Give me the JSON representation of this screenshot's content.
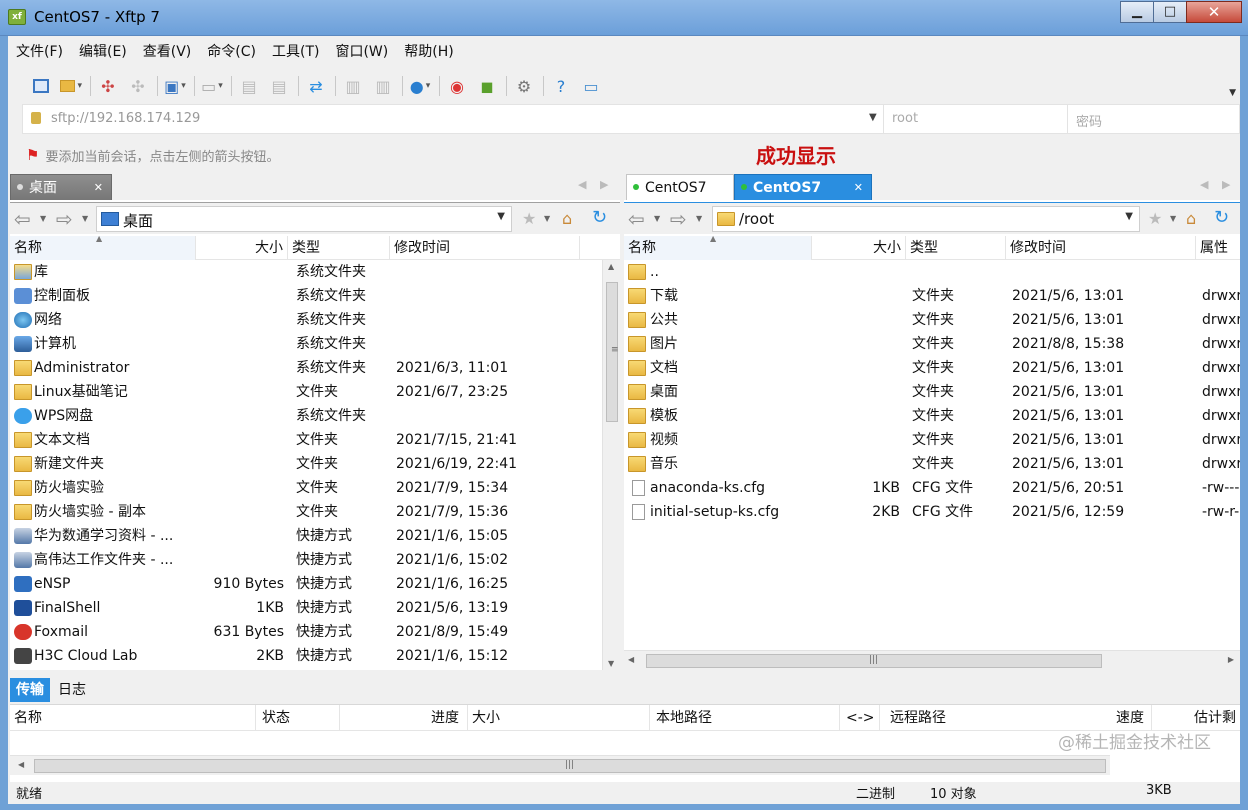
{
  "window": {
    "title": "CentOS7 - Xftp 7",
    "app_icon_text": "xf",
    "minimize": "▁",
    "maximize": "□",
    "close": "✕"
  },
  "menu": [
    "文件(F)",
    "编辑(E)",
    "查看(V)",
    "命令(C)",
    "工具(T)",
    "窗口(W)",
    "帮助(H)"
  ],
  "address": {
    "url": "sftp://192.168.174.129",
    "user_placeholder": "root",
    "password_placeholder": "密码"
  },
  "hint": "要添加当前会话，点击左侧的箭头按钮。",
  "annotation": "成功显示",
  "left_pane": {
    "tab_label": "桌面",
    "path": "桌面",
    "columns": [
      "名称",
      "大小",
      "类型",
      "修改时间"
    ],
    "rows": [
      {
        "name": "库",
        "size": "",
        "type": "系统文件夹",
        "modified": "",
        "icon": "library-icon"
      },
      {
        "name": "控制面板",
        "size": "",
        "type": "系统文件夹",
        "modified": "",
        "icon": "control-panel-icon"
      },
      {
        "name": "网络",
        "size": "",
        "type": "系统文件夹",
        "modified": "",
        "icon": "network-icon"
      },
      {
        "name": "计算机",
        "size": "",
        "type": "系统文件夹",
        "modified": "",
        "icon": "computer-icon"
      },
      {
        "name": "Administrator",
        "size": "",
        "type": "系统文件夹",
        "modified": "2021/6/3, 11:01",
        "icon": "folder-icon"
      },
      {
        "name": "Linux基础笔记",
        "size": "",
        "type": "文件夹",
        "modified": "2021/6/7, 23:25",
        "icon": "folder-icon"
      },
      {
        "name": "WPS网盘",
        "size": "",
        "type": "系统文件夹",
        "modified": "",
        "icon": "cloud-icon"
      },
      {
        "name": "文本文档",
        "size": "",
        "type": "文件夹",
        "modified": "2021/7/15, 21:41",
        "icon": "folder-icon"
      },
      {
        "name": "新建文件夹",
        "size": "",
        "type": "文件夹",
        "modified": "2021/6/19, 22:41",
        "icon": "folder-icon"
      },
      {
        "name": "防火墙实验",
        "size": "",
        "type": "文件夹",
        "modified": "2021/7/9, 15:34",
        "icon": "folder-icon"
      },
      {
        "name": "防火墙实验 - 副本",
        "size": "",
        "type": "文件夹",
        "modified": "2021/7/9, 15:36",
        "icon": "folder-icon"
      },
      {
        "name": "华为数通学习资料 - ...",
        "size": "",
        "type": "快捷方式",
        "modified": "2021/1/6, 15:05",
        "icon": "shortcut-icon"
      },
      {
        "name": "高伟达工作文件夹 - ...",
        "size": "",
        "type": "快捷方式",
        "modified": "2021/1/6, 15:02",
        "icon": "shortcut-icon"
      },
      {
        "name": "eNSP",
        "size": "910 Bytes",
        "type": "快捷方式",
        "modified": "2021/1/6, 16:25",
        "icon": "ensp-icon"
      },
      {
        "name": "FinalShell",
        "size": "1KB",
        "type": "快捷方式",
        "modified": "2021/5/6, 13:19",
        "icon": "finalshell-icon"
      },
      {
        "name": "Foxmail",
        "size": "631 Bytes",
        "type": "快捷方式",
        "modified": "2021/8/9, 15:49",
        "icon": "foxmail-icon"
      },
      {
        "name": "H3C Cloud Lab",
        "size": "2KB",
        "type": "快捷方式",
        "modified": "2021/1/6, 15:12",
        "icon": "h3c-icon"
      }
    ]
  },
  "right_pane": {
    "tabs": [
      {
        "label": "CentOS7",
        "state": "inactive"
      },
      {
        "label": "CentOS7",
        "state": "active"
      }
    ],
    "path": "/root",
    "columns": [
      "名称",
      "大小",
      "类型",
      "修改时间",
      "属性"
    ],
    "rows": [
      {
        "name": "..",
        "size": "",
        "type": "",
        "modified": "",
        "attr": "",
        "icon": "folder-icon"
      },
      {
        "name": "下载",
        "size": "",
        "type": "文件夹",
        "modified": "2021/5/6, 13:01",
        "attr": "drwxr",
        "icon": "folder-icon"
      },
      {
        "name": "公共",
        "size": "",
        "type": "文件夹",
        "modified": "2021/5/6, 13:01",
        "attr": "drwxr",
        "icon": "folder-icon"
      },
      {
        "name": "图片",
        "size": "",
        "type": "文件夹",
        "modified": "2021/8/8, 15:38",
        "attr": "drwxr",
        "icon": "folder-icon"
      },
      {
        "name": "文档",
        "size": "",
        "type": "文件夹",
        "modified": "2021/5/6, 13:01",
        "attr": "drwxr",
        "icon": "folder-icon"
      },
      {
        "name": "桌面",
        "size": "",
        "type": "文件夹",
        "modified": "2021/5/6, 13:01",
        "attr": "drwxr",
        "icon": "folder-icon"
      },
      {
        "name": "模板",
        "size": "",
        "type": "文件夹",
        "modified": "2021/5/6, 13:01",
        "attr": "drwxr",
        "icon": "folder-icon"
      },
      {
        "name": "视频",
        "size": "",
        "type": "文件夹",
        "modified": "2021/5/6, 13:01",
        "attr": "drwxr",
        "icon": "folder-icon"
      },
      {
        "name": "音乐",
        "size": "",
        "type": "文件夹",
        "modified": "2021/5/6, 13:01",
        "attr": "drwxr",
        "icon": "folder-icon"
      },
      {
        "name": "anaconda-ks.cfg",
        "size": "1KB",
        "type": "CFG 文件",
        "modified": "2021/5/6, 20:51",
        "attr": "-rw---",
        "icon": "file-icon"
      },
      {
        "name": "initial-setup-ks.cfg",
        "size": "2KB",
        "type": "CFG 文件",
        "modified": "2021/5/6, 12:59",
        "attr": "-rw-r-",
        "icon": "file-icon"
      }
    ]
  },
  "bottom": {
    "tabs": [
      "传输",
      "日志"
    ],
    "columns": [
      "名称",
      "状态",
      "进度",
      "大小",
      "本地路径",
      "<->",
      "远程路径",
      "速度",
      "估计剩"
    ]
  },
  "status": {
    "left": "就绪",
    "mode": "二进制",
    "objects": "10 对象",
    "size": "3KB"
  },
  "watermark": "@稀土掘金技术社区",
  "colors": {
    "accent": "#2a8ee0",
    "annotation": "#c91010",
    "session_dot": "#2fbf3a"
  }
}
